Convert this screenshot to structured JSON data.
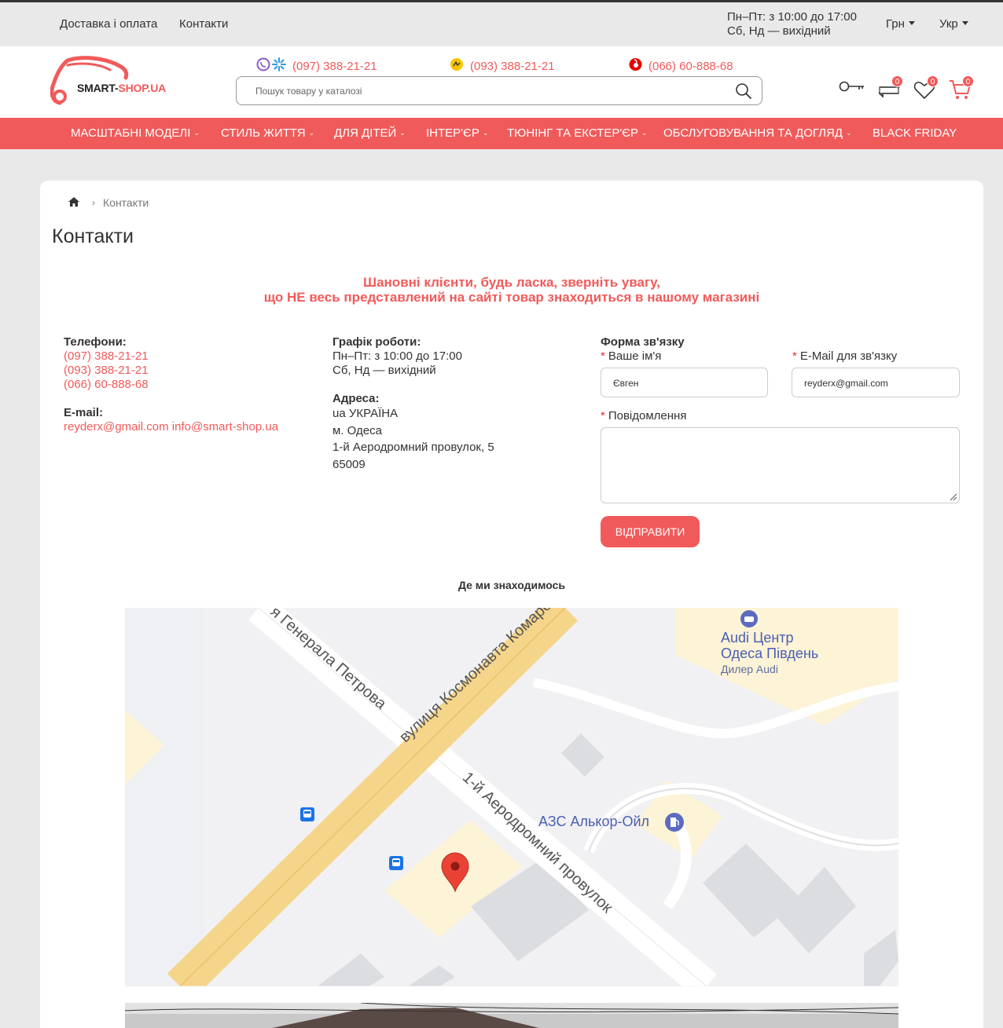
{
  "topbar": {
    "links": [
      "Доставка і оплата",
      "Контакти"
    ],
    "schedule_line1": "Пн–Пт: з 10:00 до 17:00",
    "schedule_line2": "Сб, Нд — вихідний",
    "currency": "Грн",
    "language": "Укр"
  },
  "header": {
    "logo_text_a": "SMART-",
    "logo_text_b": "SHOP.UA",
    "phones": [
      "(097) 388-21-21",
      "(093) 388-21-21",
      "(066) 60-888-68"
    ],
    "search_placeholder": "Пошук товару у каталозі",
    "compare_count": "0",
    "wishlist_count": "0",
    "cart_count": "0"
  },
  "nav": {
    "items": [
      "МАСШТАБНІ МОДЕЛІ",
      "СТИЛЬ ЖИТТЯ",
      "ДЛЯ ДІТЕЙ",
      "ІНТЕР'ЄР",
      "ТЮНІНГ ТА ЕКСТЕР'ЄР",
      "ОБСЛУГОВУВАННЯ ТА ДОГЛЯД",
      "BLACK FRIDAY"
    ]
  },
  "page": {
    "breadcrumb_current": "Контакти",
    "title": "Контакти",
    "notice_line1": "Шановні клієнти, будь ласка, зверніть увагу,",
    "notice_line2": "що НЕ весь представлений на сайті товар знаходиться в нашому магазині"
  },
  "contacts": {
    "phones_label": "Телефони:",
    "phones": [
      "(097) 388-21-21",
      "(093) 388-21-21",
      "(066) 60-888-68"
    ],
    "email_label": "E-mail:",
    "emails": [
      "reyderx@gmail.com",
      "info@smart-shop.ua"
    ],
    "schedule_label": "Графік роботи:",
    "schedule": [
      "Пн–Пт: з 10:00 до 17:00",
      "Сб, Нд — вихідний"
    ],
    "address_label": "Адреса:",
    "address": [
      "ua УКРАЇНА",
      "м. Одеса",
      "1-й Аеродромний провулок, 5",
      "65009"
    ]
  },
  "form": {
    "title": "Форма зв'язку",
    "name_label": "Ваше ім'я",
    "name_value": "Євген",
    "email_label": "E-Mail для зв'язку",
    "email_value": "reyderx@gmail.com",
    "message_label": "Повідомлення",
    "message_value": "",
    "submit": "ВІДПРАВИТИ"
  },
  "location": {
    "heading": "Де ми знаходимось",
    "map_labels": {
      "street1": "вулиця Космонавта Комарова",
      "street2": "я Генерала Петрова",
      "street3": "1-й Аеродромний провулок",
      "poi1_line1": "Audi Центр",
      "poi1_line2": "Одеса Південь",
      "poi1_sub": "Дилер Audi",
      "poi2": "АЗС Алькор-Ойл"
    }
  },
  "colors": {
    "accent": "#f15a5a",
    "map_road_major": "#f5d58a",
    "map_block": "#fdf3d6"
  }
}
